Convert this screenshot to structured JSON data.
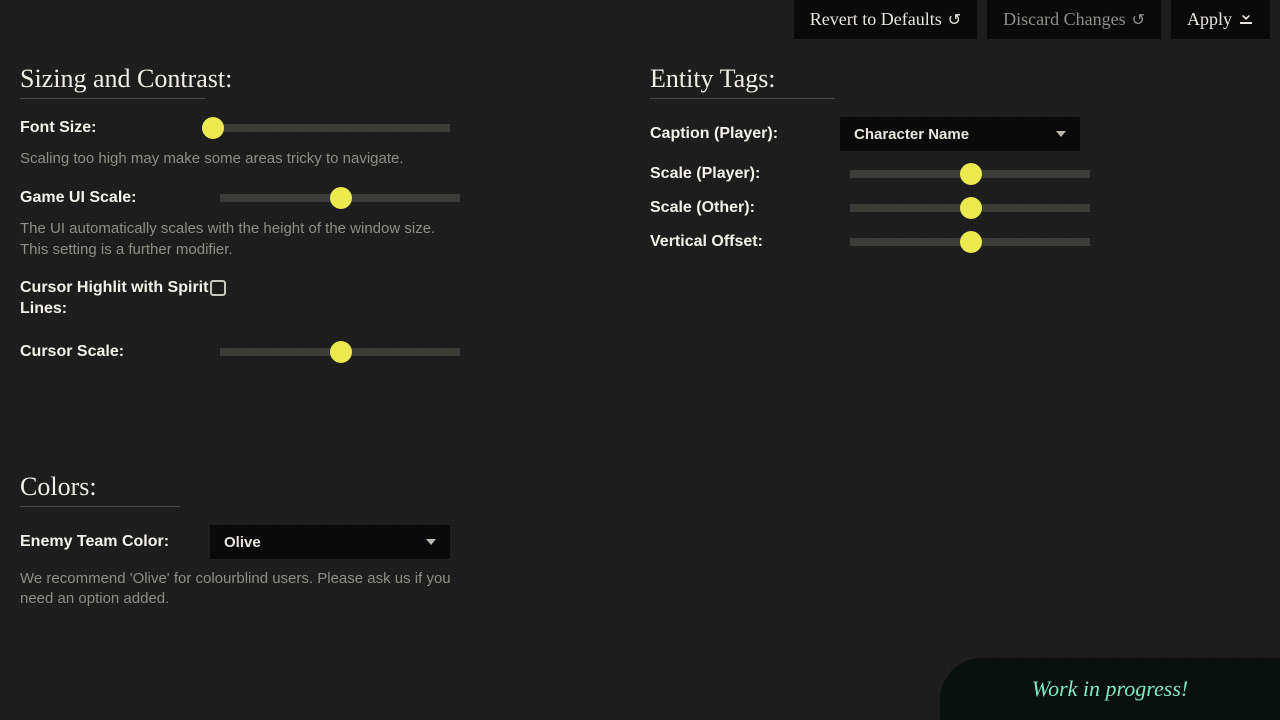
{
  "buttons": {
    "revert": "Revert to Defaults",
    "discard": "Discard Changes",
    "apply": "Apply"
  },
  "sizing": {
    "title": "Sizing and Contrast:",
    "font_size_label": "Font Size:",
    "font_size_hint": "Scaling too high may make some areas tricky to navigate.",
    "game_ui_label": "Game UI Scale:",
    "game_ui_hint": "The UI automatically scales with the height of the window size. This setting is a further modifier.",
    "cursor_highlight_label": "Cursor Highlit with Spirit Lines:",
    "cursor_scale_label": "Cursor Scale:"
  },
  "colors": {
    "title": "Colors:",
    "enemy_color_label": "Enemy Team Color:",
    "enemy_color_value": "Olive",
    "enemy_color_hint": "We recommend 'Olive' for colourblind users. Please ask us if you need an option added."
  },
  "entity": {
    "title": "Entity Tags:",
    "caption_label": "Caption (Player):",
    "caption_value": "Character Name",
    "scale_player_label": "Scale (Player):",
    "scale_other_label": "Scale (Other):",
    "vertical_offset_label": "Vertical Offset:"
  },
  "wip": "Work in progress!"
}
